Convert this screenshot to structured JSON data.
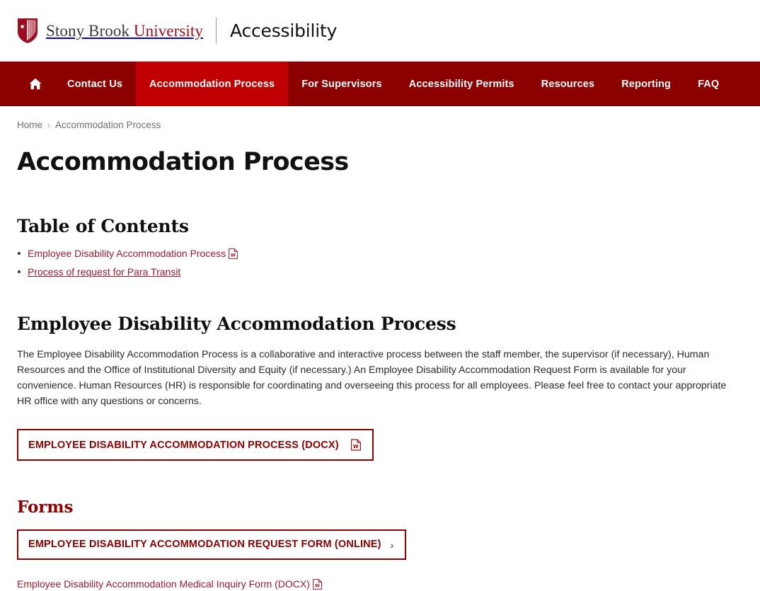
{
  "masthead": {
    "logo_icon": "stony-brook-shield-icon",
    "wordmark_part1": "Stony Brook ",
    "wordmark_part2": "University",
    "site_name": "Accessibility"
  },
  "nav": {
    "home_icon": "home-icon",
    "items": [
      {
        "label": "Contact Us",
        "active": false
      },
      {
        "label": "Accommodation Process",
        "active": true
      },
      {
        "label": "For Supervisors",
        "active": false
      },
      {
        "label": "Accessibility Permits",
        "active": false
      },
      {
        "label": "Resources",
        "active": false
      },
      {
        "label": "Reporting",
        "active": false
      },
      {
        "label": "FAQ",
        "active": false
      }
    ]
  },
  "breadcrumb": {
    "home": "Home",
    "separator": "›",
    "current": "Accommodation Process"
  },
  "page": {
    "title": "Accommodation Process"
  },
  "toc": {
    "heading": "Table of Contents",
    "items": [
      {
        "label": "Employee Disability Accommodation Process",
        "icon": "word-document-icon",
        "underlined": false
      },
      {
        "label": "Process of request for Para Transit",
        "icon": "",
        "underlined": true
      }
    ]
  },
  "section": {
    "heading": "Employee Disability Accommodation Process",
    "paragraph": "The Employee Disability Accommodation Process is a collaborative and interactive process between the staff member, the supervisor (if necessary), Human Resources and the Office of Institutional Diversity and Equity (if necessary.) An Employee Disability Accommodation Request Form is available for your convenience. Human Resources (HR) is responsible for coordinating and overseeing this process for all employees. Please feel free to contact your appropriate HR office with any questions or concerns.",
    "button_label": "EMPLOYEE DISABILITY ACCOMMODATION PROCESS (DOCX)",
    "button_icon": "word-document-icon"
  },
  "forms": {
    "heading": "Forms",
    "button_label": "EMPLOYEE DISABILITY ACCOMMODATION REQUEST FORM (ONLINE)",
    "button_chevron": "›",
    "link_label": "Employee Disability Accommodation Medical Inquiry Form (DOCX)",
    "link_icon": "word-document-icon"
  },
  "colors": {
    "nav_background": "#8c0000",
    "nav_active": "#c00000",
    "brand_red": "#9c0b1e",
    "link_red": "#9c1b2f",
    "text": "#222222"
  }
}
